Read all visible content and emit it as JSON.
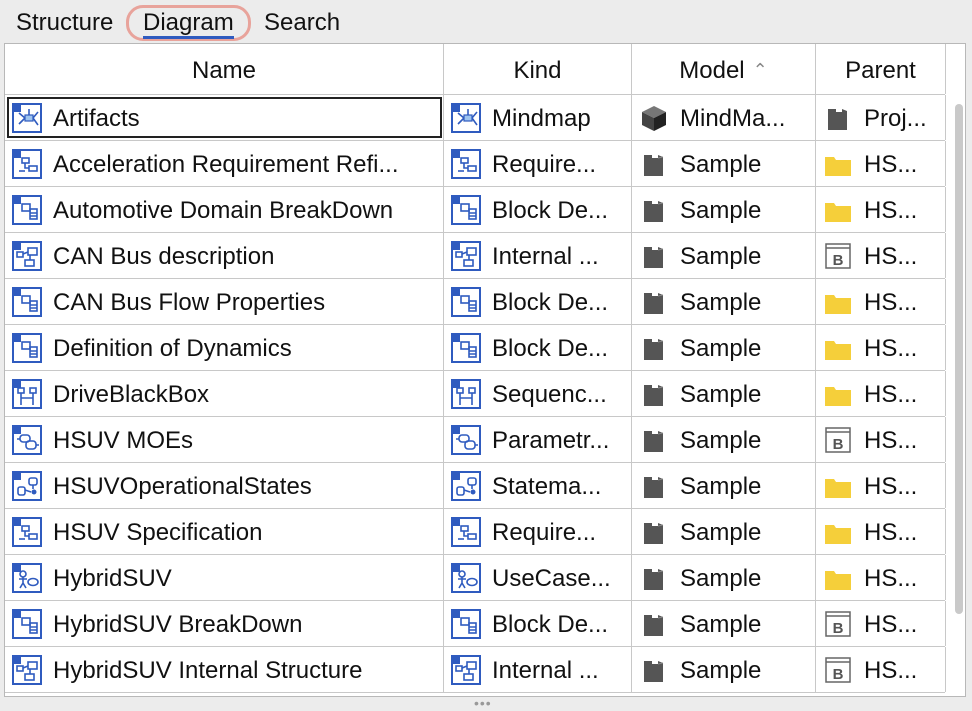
{
  "tabs": [
    {
      "label": "Structure",
      "selected": false
    },
    {
      "label": "Diagram",
      "selected": true
    },
    {
      "label": "Search",
      "selected": false
    }
  ],
  "columns": [
    "Name",
    "Kind",
    "Model",
    "Parent"
  ],
  "sort": {
    "column": "Model",
    "direction": "ascending",
    "indicator": "^"
  },
  "rows": [
    {
      "name": "Artifacts",
      "name_icon": "mindmap-diagram-icon",
      "kind": "Mindmap",
      "kind_icon": "mindmap-diagram-icon",
      "model": "MindMa...",
      "model_icon": "cube-icon",
      "parent": "Proj...",
      "parent_icon": "project-icon",
      "selected": true
    },
    {
      "name": "Acceleration Requirement Refi...",
      "name_icon": "requirement-diagram-icon",
      "kind": "Require...",
      "kind_icon": "requirement-diagram-icon",
      "model": "Sample",
      "model_icon": "model-package-icon",
      "parent": "HS...",
      "parent_icon": "folder-icon"
    },
    {
      "name": "Automotive Domain BreakDown",
      "name_icon": "block-definition-diagram-icon",
      "kind": "Block De...",
      "kind_icon": "block-definition-diagram-icon",
      "model": "Sample",
      "model_icon": "model-package-icon",
      "parent": "HS...",
      "parent_icon": "folder-icon"
    },
    {
      "name": "CAN Bus description",
      "name_icon": "internal-block-diagram-icon",
      "kind": "Internal ...",
      "kind_icon": "internal-block-diagram-icon",
      "model": "Sample",
      "model_icon": "model-package-icon",
      "parent": "HS...",
      "parent_icon": "block-icon"
    },
    {
      "name": "CAN Bus Flow Properties",
      "name_icon": "block-definition-diagram-icon",
      "kind": "Block De...",
      "kind_icon": "block-definition-diagram-icon",
      "model": "Sample",
      "model_icon": "model-package-icon",
      "parent": "HS...",
      "parent_icon": "folder-icon"
    },
    {
      "name": "Definition of Dynamics",
      "name_icon": "block-definition-diagram-icon",
      "kind": "Block De...",
      "kind_icon": "block-definition-diagram-icon",
      "model": "Sample",
      "model_icon": "model-package-icon",
      "parent": "HS...",
      "parent_icon": "folder-icon"
    },
    {
      "name": "DriveBlackBox",
      "name_icon": "sequence-diagram-icon",
      "kind": "Sequenc...",
      "kind_icon": "sequence-diagram-icon",
      "model": "Sample",
      "model_icon": "model-package-icon",
      "parent": "HS...",
      "parent_icon": "folder-icon"
    },
    {
      "name": "HSUV MOEs",
      "name_icon": "parametric-diagram-icon",
      "kind": "Parametr...",
      "kind_icon": "parametric-diagram-icon",
      "model": "Sample",
      "model_icon": "model-package-icon",
      "parent": "HS...",
      "parent_icon": "block-icon"
    },
    {
      "name": "HSUVOperationalStates",
      "name_icon": "state-machine-diagram-icon",
      "kind": "Statema...",
      "kind_icon": "state-machine-diagram-icon",
      "model": "Sample",
      "model_icon": "model-package-icon",
      "parent": "HS...",
      "parent_icon": "folder-icon"
    },
    {
      "name": "HSUV Specification",
      "name_icon": "requirement-diagram-icon",
      "kind": "Require...",
      "kind_icon": "requirement-diagram-icon",
      "model": "Sample",
      "model_icon": "model-package-icon",
      "parent": "HS...",
      "parent_icon": "folder-icon"
    },
    {
      "name": "HybridSUV",
      "name_icon": "use-case-diagram-icon",
      "kind": "UseCase...",
      "kind_icon": "use-case-diagram-icon",
      "model": "Sample",
      "model_icon": "model-package-icon",
      "parent": "HS...",
      "parent_icon": "folder-icon"
    },
    {
      "name": "HybridSUV BreakDown",
      "name_icon": "block-definition-diagram-icon",
      "kind": "Block De...",
      "kind_icon": "block-definition-diagram-icon",
      "model": "Sample",
      "model_icon": "model-package-icon",
      "parent": "HS...",
      "parent_icon": "block-icon"
    },
    {
      "name": "HybridSUV Internal Structure",
      "name_icon": "internal-block-diagram-icon",
      "kind": "Internal ...",
      "kind_icon": "internal-block-diagram-icon",
      "model": "Sample",
      "model_icon": "model-package-icon",
      "parent": "HS...",
      "parent_icon": "block-icon"
    }
  ],
  "colors": {
    "icon_blue": "#2f5bbf",
    "folder_yellow": "#f5cf3a",
    "package_gray": "#555555",
    "tab_highlight": "#e8a39b"
  }
}
